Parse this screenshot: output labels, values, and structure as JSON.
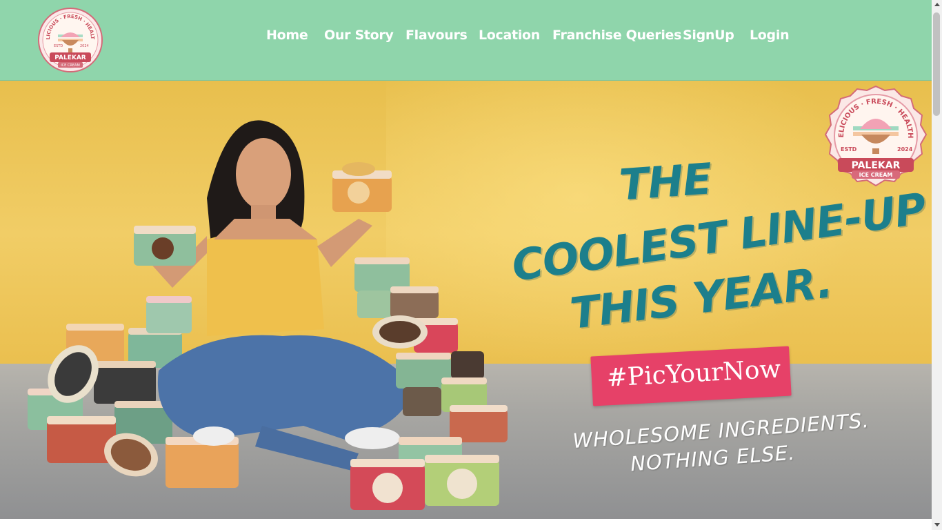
{
  "brand": {
    "arc_text": "DELICIOUS · FRESH · HEALTHY",
    "estd_label": "ESTD",
    "estd_year": "2024",
    "name": "PALEKAR",
    "subtitle": "ICE CREAM"
  },
  "nav": {
    "items": [
      {
        "label": "Home"
      },
      {
        "label": "Our Story"
      },
      {
        "label": "Flavours"
      },
      {
        "label": "Location"
      },
      {
        "label": "Franchise Queries"
      },
      {
        "label": "SignUp"
      },
      {
        "label": "Login"
      }
    ]
  },
  "hero": {
    "headline_1": "THE",
    "headline_2": "COOLEST LINE-UP",
    "headline_3": "THIS YEAR.",
    "hashtag": "#PicYourNow",
    "tagline_1": "WHOLESOME INGREDIENTS.",
    "tagline_2": "NOTHING ELSE."
  },
  "colors": {
    "nav_bg": "#8fd5ab",
    "headline": "#1c7f8c",
    "hashtag_bg": "#e64168",
    "badge_red": "#c94a5a"
  }
}
